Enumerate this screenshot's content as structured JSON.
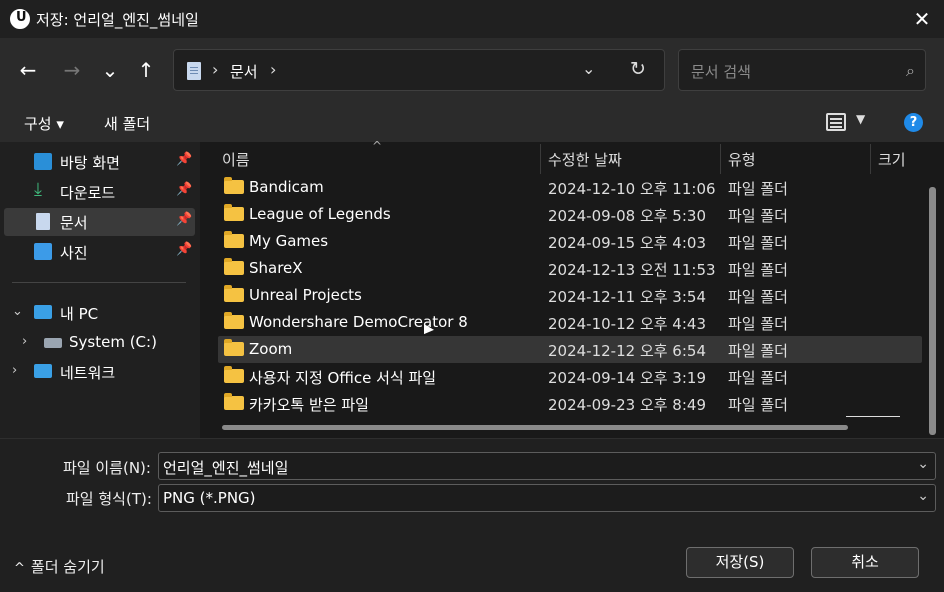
{
  "window": {
    "title": "저장: 언리얼_엔진_썸네일",
    "app_icon_letter": "U",
    "close_glyph": "✕"
  },
  "nav": {
    "back": "←",
    "forward": "→",
    "recent": "⌄",
    "up": "↑"
  },
  "address": {
    "sep1": "›",
    "crumb": "문서",
    "sep2": "›",
    "dropdown_glyph": "⌄",
    "refresh_glyph": "↻"
  },
  "search": {
    "placeholder": "문서 검색",
    "icon_glyph": "⌕"
  },
  "toolbar": {
    "organize": "구성 ▾",
    "new_folder": "새 폴더",
    "view_caret": "▼",
    "help": "?"
  },
  "sidebar": {
    "items": [
      {
        "label": "바탕 화면",
        "icon": "desktop-icon",
        "pinned": true
      },
      {
        "label": "다운로드",
        "icon": "download-icon",
        "pinned": true
      },
      {
        "label": "문서",
        "icon": "document-icon",
        "pinned": true,
        "selected": true
      },
      {
        "label": "사진",
        "icon": "pictures-icon",
        "pinned": true
      }
    ],
    "pin_glyph": "📌",
    "this_pc": "내 PC",
    "system_drive": "System (C:)",
    "network": "네트워크"
  },
  "columns": {
    "name": "이름",
    "date": "수정한 날짜",
    "type": "유형",
    "size": "크기",
    "sort_glyph": "^"
  },
  "files": [
    {
      "name": "Bandicam",
      "date": "2024-12-10 오후 11:06",
      "type": "파일 폴더"
    },
    {
      "name": "League of Legends",
      "date": "2024-09-08 오후 5:30",
      "type": "파일 폴더"
    },
    {
      "name": "My Games",
      "date": "2024-09-15 오후 4:03",
      "type": "파일 폴더"
    },
    {
      "name": "ShareX",
      "date": "2024-12-13 오전 11:53",
      "type": "파일 폴더"
    },
    {
      "name": "Unreal Projects",
      "date": "2024-12-11 오후 3:54",
      "type": "파일 폴더"
    },
    {
      "name": "Wondershare DemoCreator 8",
      "date": "2024-10-12 오후 4:43",
      "type": "파일 폴더"
    },
    {
      "name": "Zoom",
      "date": "2024-12-12 오후 6:54",
      "type": "파일 폴더"
    },
    {
      "name": "사용자 지정 Office 서식 파일",
      "date": "2024-09-14 오후 3:19",
      "type": "파일 폴더"
    },
    {
      "name": "카카오톡 받은 파일",
      "date": "2024-09-23 오후 8:49",
      "type": "파일 폴더"
    }
  ],
  "form": {
    "filename_label": "파일 이름(N):",
    "filename_value": "언리얼_엔진_썸네일",
    "filetype_label": "파일 형식(T):",
    "filetype_value": "PNG (*.PNG)",
    "dropdown_glyph": "⌄"
  },
  "buttons": {
    "save": "저장(S)",
    "cancel": "취소"
  },
  "hide_folders": {
    "caret": "^",
    "label": "폴더 숨기기"
  },
  "colors": {
    "accent": "#1f8ae8",
    "folder": "#f5c242",
    "background": "#202020"
  }
}
